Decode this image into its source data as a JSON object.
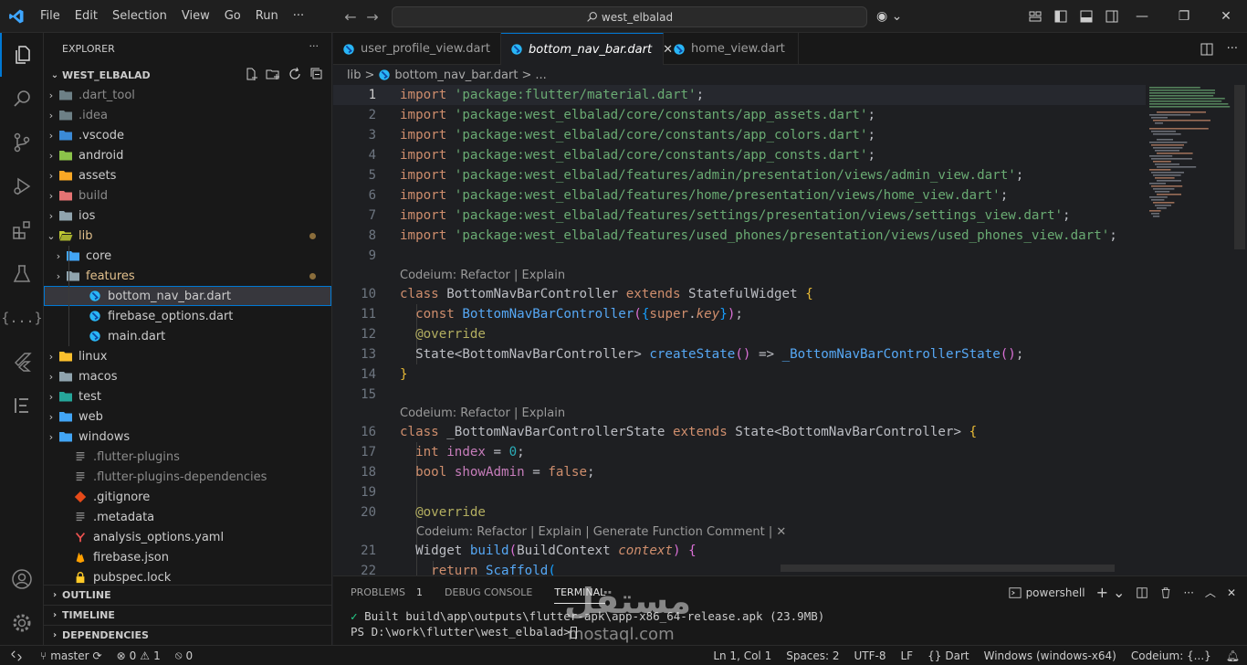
{
  "titlebar": {
    "menu": [
      "File",
      "Edit",
      "Selection",
      "View",
      "Go",
      "Run",
      "···"
    ],
    "search": "west_elbalad"
  },
  "activity": {
    "icons": [
      "explorer-icon",
      "search-icon",
      "source-control-icon",
      "run-debug-icon",
      "extensions-icon",
      "testing-icon",
      "json-icon",
      "flutter-icon",
      "outline-icon"
    ],
    "bottom": [
      "account-icon",
      "settings-icon"
    ]
  },
  "sidebar": {
    "title": "EXPLORER",
    "more": "···",
    "root": "WEST_ELBALAD",
    "items": [
      {
        "label": ".dart_tool",
        "kind": "folder",
        "dim": true,
        "color": "#6d8086"
      },
      {
        "label": ".idea",
        "kind": "folder",
        "dim": true,
        "color": "#6d8086"
      },
      {
        "label": ".vscode",
        "kind": "folder",
        "color": "#3b8ad6"
      },
      {
        "label": "android",
        "kind": "folder",
        "color": "#8bc34a"
      },
      {
        "label": "assets",
        "kind": "folder",
        "color": "#f9a825"
      },
      {
        "label": "build",
        "kind": "folder",
        "dim": true,
        "color": "#e57373"
      },
      {
        "label": "ios",
        "kind": "folder",
        "color": "#90a4ae"
      },
      {
        "label": "lib",
        "kind": "folder-open",
        "color": "#c0ca33",
        "modified": true
      },
      {
        "label": "core",
        "kind": "folder",
        "color": "#42a5f5",
        "depth": 1
      },
      {
        "label": "features",
        "kind": "folder",
        "color": "#90a4ae",
        "depth": 1,
        "modified": true,
        "accent": true
      },
      {
        "label": "bottom_nav_bar.dart",
        "kind": "dart",
        "depth": 2,
        "selected": true
      },
      {
        "label": "firebase_options.dart",
        "kind": "dart",
        "depth": 2
      },
      {
        "label": "main.dart",
        "kind": "dart",
        "depth": 2
      },
      {
        "label": "linux",
        "kind": "folder",
        "color": "#fbc02d"
      },
      {
        "label": "macos",
        "kind": "folder",
        "color": "#90a4ae"
      },
      {
        "label": "test",
        "kind": "folder",
        "color": "#26a69a"
      },
      {
        "label": "web",
        "kind": "folder",
        "color": "#42a5f5"
      },
      {
        "label": "windows",
        "kind": "folder",
        "color": "#42a5f5"
      },
      {
        "label": ".flutter-plugins",
        "kind": "file",
        "dim": true
      },
      {
        "label": ".flutter-plugins-dependencies",
        "kind": "file",
        "dim": true
      },
      {
        "label": ".gitignore",
        "kind": "git"
      },
      {
        "label": ".metadata",
        "kind": "file"
      },
      {
        "label": "analysis_options.yaml",
        "kind": "yaml"
      },
      {
        "label": "firebase.json",
        "kind": "firebase"
      },
      {
        "label": "pubspec.lock",
        "kind": "lock"
      }
    ],
    "sections": [
      "OUTLINE",
      "TIMELINE",
      "DEPENDENCIES"
    ]
  },
  "editor": {
    "tabs": [
      {
        "label": "user_profile_view.dart",
        "active": false
      },
      {
        "label": "bottom_nav_bar.dart",
        "active": true
      },
      {
        "label": "home_view.dart",
        "active": false
      }
    ],
    "breadcrumb": [
      "lib",
      ">",
      "bottom_nav_bar.dart",
      ">",
      "..."
    ],
    "lens1": "Codeium: Refactor | Explain",
    "lens2": "Codeium: Refactor | Explain",
    "lens3": "Codeium: Refactor | Explain | Generate Function Comment | ✕",
    "line_numbers": [
      "1",
      "2",
      "3",
      "4",
      "5",
      "6",
      "7",
      "8",
      "9",
      "10",
      "11",
      "12",
      "13",
      "14",
      "15",
      "16",
      "17",
      "18",
      "19",
      "20",
      "21",
      "22"
    ],
    "imports": [
      "'package:flutter/material.dart'",
      "'package:west_elbalad/core/constants/app_assets.dart'",
      "'package:west_elbalad/core/constants/app_colors.dart'",
      "'package:west_elbalad/core/constants/app_consts.dart'",
      "'package:west_elbalad/features/admin/presentation/views/admin_view.dart'",
      "'package:west_elbalad/features/home/presentation/views/home_view.dart'",
      "'package:west_elbalad/features/settings/presentation/views/settings_view.dart'",
      "'package:west_elbalad/features/used_phones/presentation/views/used_phones_view.dart'"
    ]
  },
  "panel": {
    "tabs": [
      "PROBLEMS",
      "DEBUG CONSOLE",
      "TERMINAL"
    ],
    "problems_count": "1",
    "shell": "powershell",
    "line1_check": "✓",
    "line1": "Built build\\app\\outputs\\flutter-apk\\app-x86_64-release.apk (23.9MB)",
    "line2": "PS D:\\work\\flutter\\west_elbalad>"
  },
  "statusbar": {
    "branch": "master",
    "errors": "0",
    "warnings": "1",
    "ports": "0",
    "position": "Ln 1, Col 1",
    "spaces": "Spaces: 2",
    "encoding": "UTF-8",
    "eol": "LF",
    "language": "Dart",
    "device": "Windows (windows-x64)",
    "codeium": "Codeium: {...}"
  },
  "watermark": {
    "arabic": "مستقل",
    "latin": "mostaql.com"
  }
}
